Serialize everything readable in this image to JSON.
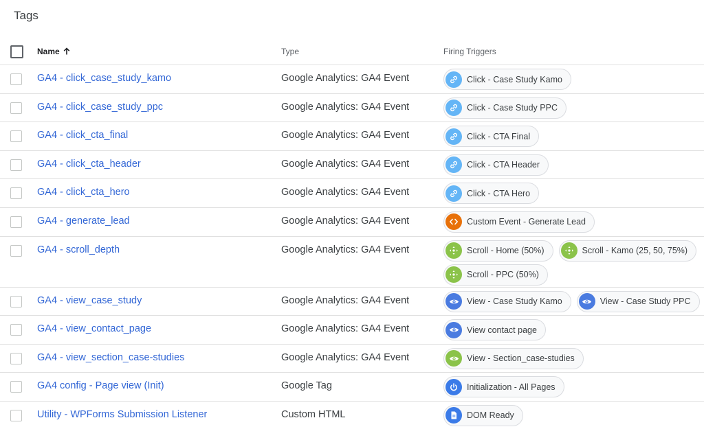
{
  "page": {
    "title": "Tags"
  },
  "table": {
    "columns": {
      "name": "Name",
      "type": "Type",
      "triggers": "Firing Triggers"
    },
    "rows": [
      {
        "name": "GA4 - click_case_study_kamo",
        "type": "Google Analytics: GA4 Event",
        "triggers": [
          {
            "label": "Click - Case Study Kamo",
            "icon": "link-icon"
          }
        ]
      },
      {
        "name": "GA4 - click_case_study_ppc",
        "type": "Google Analytics: GA4 Event",
        "triggers": [
          {
            "label": "Click - Case Study PPC",
            "icon": "link-icon"
          }
        ]
      },
      {
        "name": "GA4 - click_cta_final",
        "type": "Google Analytics: GA4 Event",
        "triggers": [
          {
            "label": "Click - CTA Final",
            "icon": "link-icon"
          }
        ]
      },
      {
        "name": "GA4 - click_cta_header",
        "type": "Google Analytics: GA4 Event",
        "triggers": [
          {
            "label": "Click - CTA Header",
            "icon": "link-icon"
          }
        ]
      },
      {
        "name": "GA4 - click_cta_hero",
        "type": "Google Analytics: GA4 Event",
        "triggers": [
          {
            "label": "Click - CTA Hero",
            "icon": "link-icon"
          }
        ]
      },
      {
        "name": "GA4 - generate_lead",
        "type": "Google Analytics: GA4 Event",
        "triggers": [
          {
            "label": "Custom Event - Generate Lead",
            "icon": "code-icon"
          }
        ]
      },
      {
        "name": "GA4 - scroll_depth",
        "type": "Google Analytics: GA4 Event",
        "triggers": [
          {
            "label": "Scroll - Home (50%)",
            "icon": "scroll-icon"
          },
          {
            "label": "Scroll - Kamo (25, 50, 75%)",
            "icon": "scroll-icon"
          },
          {
            "label": "Scroll - PPC (50%)",
            "icon": "scroll-icon"
          }
        ]
      },
      {
        "name": "GA4 - view_case_study",
        "type": "Google Analytics: GA4 Event",
        "triggers": [
          {
            "label": "View - Case Study Kamo",
            "icon": "eye-icon"
          },
          {
            "label": "View - Case Study PPC",
            "icon": "eye-icon"
          }
        ]
      },
      {
        "name": "GA4 - view_contact_page",
        "type": "Google Analytics: GA4 Event",
        "triggers": [
          {
            "label": "View contact page",
            "icon": "eye-icon"
          }
        ]
      },
      {
        "name": "GA4 - view_section_case-studies",
        "type": "Google Analytics: GA4 Event",
        "triggers": [
          {
            "label": "View - Section_case-studies",
            "icon": "eye-icon-green"
          }
        ]
      },
      {
        "name": "GA4 config - Page view (Init)",
        "type": "Google Tag",
        "triggers": [
          {
            "label": "Initialization - All Pages",
            "icon": "power-icon"
          }
        ]
      },
      {
        "name": "Utility - WPForms Submission Listener",
        "type": "Custom HTML",
        "triggers": [
          {
            "label": "DOM Ready",
            "icon": "document-icon"
          }
        ]
      }
    ]
  },
  "colors": {
    "link": "#3367d6",
    "click_trigger": "#64b5f6",
    "custom_event_trigger": "#e8710a",
    "scroll_trigger": "#8bc34a",
    "view_trigger": "#4a7be0",
    "init_trigger": "#3b7be8"
  }
}
